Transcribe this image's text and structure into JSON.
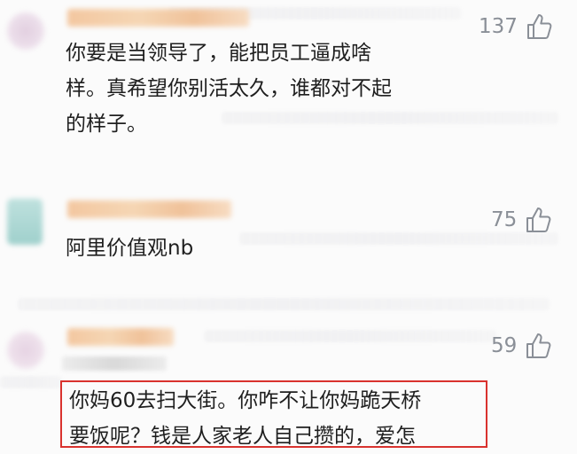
{
  "comments": [
    {
      "likes": "137",
      "text": "你要是当领导了，能把员工逼成啥\n样。真希望你别活太久，谁都对不起\n的样子。"
    },
    {
      "likes": "75",
      "text": "阿里价值观nb"
    },
    {
      "likes": "59",
      "text": "你妈60去扫大街。你咋不让你妈跪天桥\n要饭呢？钱是人家老人自己攒的，爱怎"
    }
  ],
  "icons": {
    "like": "thumbs-up-icon"
  },
  "colors": {
    "highlight_border": "#d9322e",
    "like_gray": "#8a8f97"
  }
}
